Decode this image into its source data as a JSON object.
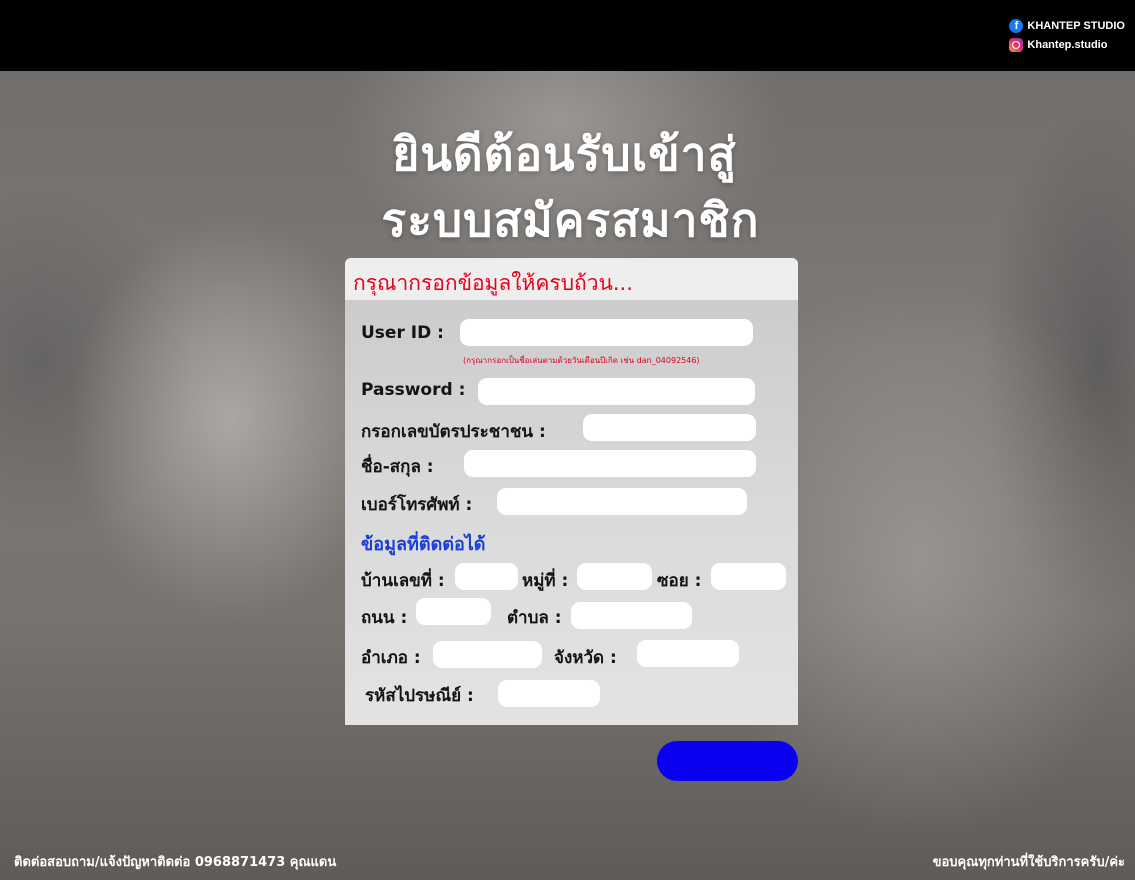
{
  "social": {
    "facebook": "KHANTEP STUDIO",
    "instagram": "Khantep.studio"
  },
  "page": {
    "title_line1": "ยินดีต้อนรับเข้าสู่",
    "title_line2": "ระบบสมัครสมาชิก"
  },
  "form": {
    "header": "กรุณากรอกข้อมูลให้ครบถ้วน...",
    "fields": {
      "user_id": {
        "label": "User ID :",
        "value": "",
        "hint": "(กรุณากรอกเป็นชื่อเล่นตามด้วยวันเดือนปีเกิด เช่น dan_04092546)"
      },
      "password": {
        "label": "Password :",
        "value": ""
      },
      "id_card": {
        "label": "กรอกเลขบัตรประชาชน :",
        "value": ""
      },
      "full_name": {
        "label": "ชื่อ-สกุล :",
        "value": ""
      },
      "phone": {
        "label": "เบอร์โทรศัพท์ :",
        "value": ""
      }
    },
    "contact_section": "ข้อมูลที่ติดต่อได้",
    "address": {
      "house_no": {
        "label": "บ้านเลขที่ :",
        "value": ""
      },
      "moo": {
        "label": "หมู่ที่ :",
        "value": ""
      },
      "soi": {
        "label": "ซอย :",
        "value": ""
      },
      "road": {
        "label": "ถนน :",
        "value": ""
      },
      "subdistrict": {
        "label": "ตำบล :",
        "value": ""
      },
      "district": {
        "label": "อำเภอ :",
        "value": ""
      },
      "province": {
        "label": "จังหวัด :",
        "value": ""
      },
      "postcode": {
        "label": "รหัสไปรษณีย์ :",
        "value": ""
      }
    },
    "submit_color": "#0a00f0"
  },
  "footer": {
    "contact": "ติดต่อสอบถาม/แจ้งปัญหาติดต่อ 0968871473 คุณแดน",
    "thanks": "ขอบคุณทุกท่านที่ใช้บริการครับ/ค่ะ"
  },
  "colors": {
    "topbar": "#000000",
    "header_text": "#e8001b",
    "section_text": "#1a3fd6"
  }
}
